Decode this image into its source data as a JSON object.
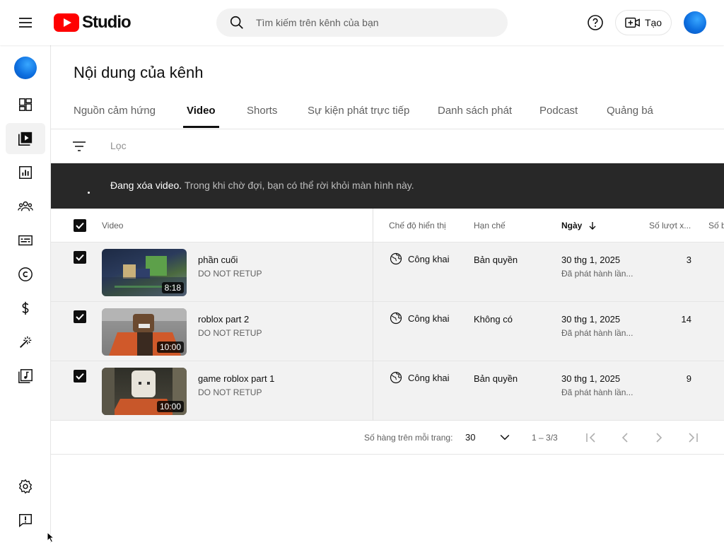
{
  "header": {
    "logo_text": "Studio",
    "search_placeholder": "Tìm kiếm trên kênh của bạn",
    "create_label": "Tạo"
  },
  "page": {
    "title": "Nội dung của kênh"
  },
  "tabs": [
    {
      "label": "Nguồn cảm hứng"
    },
    {
      "label": "Video"
    },
    {
      "label": "Shorts"
    },
    {
      "label": "Sự kiện phát trực tiếp"
    },
    {
      "label": "Danh sách phát"
    },
    {
      "label": "Podcast"
    },
    {
      "label": "Quảng bá"
    }
  ],
  "filter": {
    "label": "Lọc"
  },
  "banner": {
    "bold_text": "Đang xóa video.",
    "text": " Trong khi chờ đợi, bạn có thể rời khỏi màn hình này."
  },
  "table": {
    "headers": {
      "video": "Video",
      "visibility": "Chế độ hiển thị",
      "restrictions": "Hạn chế",
      "date": "Ngày",
      "views": "Số lượt x...",
      "comments": "Số b"
    },
    "rows": [
      {
        "title": "phần cuối",
        "description": "DO NOT RETUP",
        "duration": "8:18",
        "visibility": "Công khai",
        "restriction": "Bản quyền",
        "date": "30 thg 1, 2025",
        "date_status": "Đã phát hành lần...",
        "views": "3",
        "thumb_colors": [
          "#26324a",
          "#3d5a3c",
          "#6b7a8f"
        ]
      },
      {
        "title": "roblox part 2",
        "description": "DO NOT RETUP",
        "duration": "10:00",
        "visibility": "Công khai",
        "restriction": "Không có",
        "date": "30 thg 1, 2025",
        "date_status": "Đã phát hành lần...",
        "views": "14",
        "thumb_colors": [
          "#8a8a8a",
          "#d0592a",
          "#5a3a2a"
        ]
      },
      {
        "title": "game roblox part 1",
        "description": "DO NOT RETUP",
        "duration": "10:00",
        "visibility": "Công khai",
        "restriction": "Bản quyền",
        "date": "30 thg 1, 2025",
        "date_status": "Đã phát hành lần...",
        "views": "9",
        "thumb_colors": [
          "#3a3a32",
          "#e8e4da",
          "#c8572a"
        ]
      }
    ]
  },
  "pagination": {
    "rows_label": "Số hàng trên mỗi trang:",
    "rows_per_page": "30",
    "range": "1 – 3/3"
  },
  "colors": {
    "brand_red": "#ff0000",
    "banner_bg": "#282828",
    "row_selected_bg": "#f2f2f2"
  }
}
